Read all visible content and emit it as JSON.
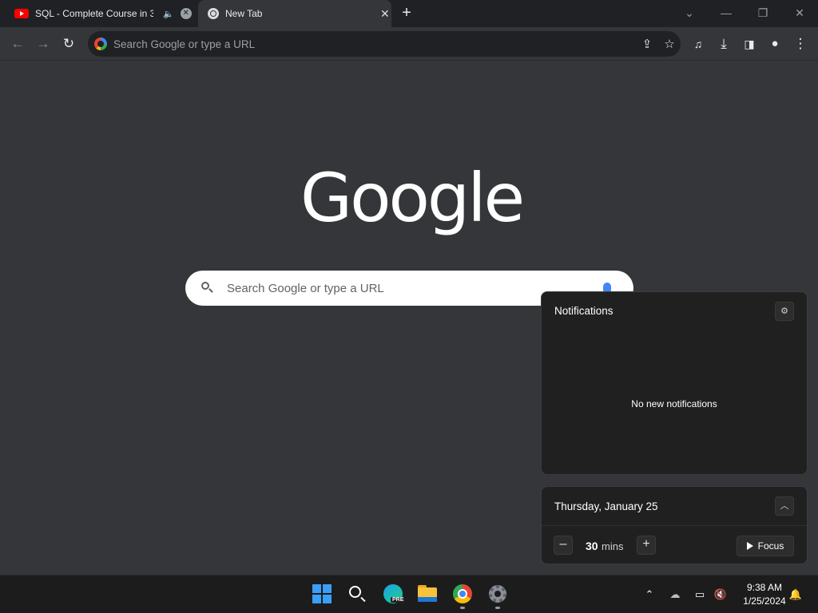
{
  "browser": {
    "tabs": [
      {
        "title": "SQL - Complete Course in 3",
        "favicon": "youtube-icon",
        "audio": "speaker-icon"
      },
      {
        "title": "New Tab",
        "favicon": "chrome-icon"
      }
    ],
    "omnibox_placeholder": "Search Google or type a URL"
  },
  "page": {
    "logo": "Google",
    "search_placeholder": "Search Google or type a URL"
  },
  "notification_center": {
    "title": "Notifications",
    "empty_message": "No new notifications"
  },
  "calendar": {
    "date": "Thursday, January 25",
    "focus_minutes": "30",
    "focus_unit": "mins",
    "focus_button": "Focus"
  },
  "taskbar": {
    "apps": [
      "start-icon",
      "search-icon",
      "edge-pre-icon",
      "file-explorer-icon",
      "chrome-icon",
      "settings-icon"
    ],
    "edge_badge": "PRE",
    "time": "9:38 AM",
    "date": "1/25/2024"
  }
}
